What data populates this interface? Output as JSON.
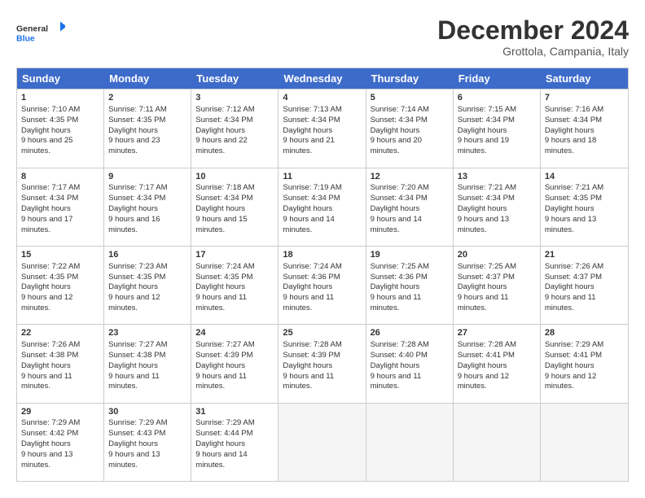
{
  "header": {
    "logo_general": "General",
    "logo_blue": "Blue",
    "month": "December 2024",
    "location": "Grottola, Campania, Italy"
  },
  "days_of_week": [
    "Sunday",
    "Monday",
    "Tuesday",
    "Wednesday",
    "Thursday",
    "Friday",
    "Saturday"
  ],
  "weeks": [
    [
      {
        "day": 1,
        "sunrise": "7:10 AM",
        "sunset": "4:35 PM",
        "daylight": "9 hours and 25 minutes."
      },
      {
        "day": 2,
        "sunrise": "7:11 AM",
        "sunset": "4:35 PM",
        "daylight": "9 hours and 23 minutes."
      },
      {
        "day": 3,
        "sunrise": "7:12 AM",
        "sunset": "4:34 PM",
        "daylight": "9 hours and 22 minutes."
      },
      {
        "day": 4,
        "sunrise": "7:13 AM",
        "sunset": "4:34 PM",
        "daylight": "9 hours and 21 minutes."
      },
      {
        "day": 5,
        "sunrise": "7:14 AM",
        "sunset": "4:34 PM",
        "daylight": "9 hours and 20 minutes."
      },
      {
        "day": 6,
        "sunrise": "7:15 AM",
        "sunset": "4:34 PM",
        "daylight": "9 hours and 19 minutes."
      },
      {
        "day": 7,
        "sunrise": "7:16 AM",
        "sunset": "4:34 PM",
        "daylight": "9 hours and 18 minutes."
      }
    ],
    [
      {
        "day": 8,
        "sunrise": "7:17 AM",
        "sunset": "4:34 PM",
        "daylight": "9 hours and 17 minutes."
      },
      {
        "day": 9,
        "sunrise": "7:17 AM",
        "sunset": "4:34 PM",
        "daylight": "9 hours and 16 minutes."
      },
      {
        "day": 10,
        "sunrise": "7:18 AM",
        "sunset": "4:34 PM",
        "daylight": "9 hours and 15 minutes."
      },
      {
        "day": 11,
        "sunrise": "7:19 AM",
        "sunset": "4:34 PM",
        "daylight": "9 hours and 14 minutes."
      },
      {
        "day": 12,
        "sunrise": "7:20 AM",
        "sunset": "4:34 PM",
        "daylight": "9 hours and 14 minutes."
      },
      {
        "day": 13,
        "sunrise": "7:21 AM",
        "sunset": "4:34 PM",
        "daylight": "9 hours and 13 minutes."
      },
      {
        "day": 14,
        "sunrise": "7:21 AM",
        "sunset": "4:35 PM",
        "daylight": "9 hours and 13 minutes."
      }
    ],
    [
      {
        "day": 15,
        "sunrise": "7:22 AM",
        "sunset": "4:35 PM",
        "daylight": "9 hours and 12 minutes."
      },
      {
        "day": 16,
        "sunrise": "7:23 AM",
        "sunset": "4:35 PM",
        "daylight": "9 hours and 12 minutes."
      },
      {
        "day": 17,
        "sunrise": "7:24 AM",
        "sunset": "4:35 PM",
        "daylight": "9 hours and 11 minutes."
      },
      {
        "day": 18,
        "sunrise": "7:24 AM",
        "sunset": "4:36 PM",
        "daylight": "9 hours and 11 minutes."
      },
      {
        "day": 19,
        "sunrise": "7:25 AM",
        "sunset": "4:36 PM",
        "daylight": "9 hours and 11 minutes."
      },
      {
        "day": 20,
        "sunrise": "7:25 AM",
        "sunset": "4:37 PM",
        "daylight": "9 hours and 11 minutes."
      },
      {
        "day": 21,
        "sunrise": "7:26 AM",
        "sunset": "4:37 PM",
        "daylight": "9 hours and 11 minutes."
      }
    ],
    [
      {
        "day": 22,
        "sunrise": "7:26 AM",
        "sunset": "4:38 PM",
        "daylight": "9 hours and 11 minutes."
      },
      {
        "day": 23,
        "sunrise": "7:27 AM",
        "sunset": "4:38 PM",
        "daylight": "9 hours and 11 minutes."
      },
      {
        "day": 24,
        "sunrise": "7:27 AM",
        "sunset": "4:39 PM",
        "daylight": "9 hours and 11 minutes."
      },
      {
        "day": 25,
        "sunrise": "7:28 AM",
        "sunset": "4:39 PM",
        "daylight": "9 hours and 11 minutes."
      },
      {
        "day": 26,
        "sunrise": "7:28 AM",
        "sunset": "4:40 PM",
        "daylight": "9 hours and 11 minutes."
      },
      {
        "day": 27,
        "sunrise": "7:28 AM",
        "sunset": "4:41 PM",
        "daylight": "9 hours and 12 minutes."
      },
      {
        "day": 28,
        "sunrise": "7:29 AM",
        "sunset": "4:41 PM",
        "daylight": "9 hours and 12 minutes."
      }
    ],
    [
      {
        "day": 29,
        "sunrise": "7:29 AM",
        "sunset": "4:42 PM",
        "daylight": "9 hours and 13 minutes."
      },
      {
        "day": 30,
        "sunrise": "7:29 AM",
        "sunset": "4:43 PM",
        "daylight": "9 hours and 13 minutes."
      },
      {
        "day": 31,
        "sunrise": "7:29 AM",
        "sunset": "4:44 PM",
        "daylight": "9 hours and 14 minutes."
      },
      null,
      null,
      null,
      null
    ]
  ]
}
